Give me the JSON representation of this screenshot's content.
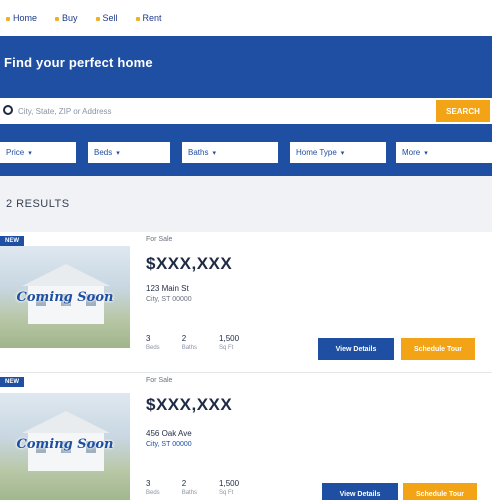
{
  "nav": {
    "items": [
      "Home",
      "Buy",
      "Sell",
      "Rent"
    ]
  },
  "hero": {
    "title": "Find your perfect home"
  },
  "search": {
    "placeholder": "City, State, ZIP or Address",
    "button_label": "SEARCH"
  },
  "filters": [
    "Price",
    "Beds",
    "Baths",
    "Home Type",
    "More"
  ],
  "results": {
    "count_label": "2 RESULTS"
  },
  "listings": [
    {
      "badge": "NEW",
      "photo_text": "Coming Soon",
      "status": "For Sale",
      "price": "$XXX,XXX",
      "address": "123 Main St",
      "city": "City, ST 00000",
      "stats": [
        {
          "value": "3",
          "label": "Beds"
        },
        {
          "value": "2",
          "label": "Baths"
        },
        {
          "value": "1,500",
          "label": "Sq Ft"
        }
      ],
      "details_label": "View Details",
      "tour_label": "Schedule Tour"
    },
    {
      "badge": "NEW",
      "photo_text": "Coming Soon",
      "status": "For Sale",
      "price": "$XXX,XXX",
      "address": "456 Oak Ave",
      "city": "City, ST 00000",
      "mls": "",
      "stats": [
        {
          "value": "3",
          "label": "Beds"
        },
        {
          "value": "2",
          "label": "Baths"
        },
        {
          "value": "1,500",
          "label": "Sq Ft"
        }
      ],
      "details_label": "View Details",
      "tour_label": "Schedule Tour"
    }
  ],
  "colors": {
    "brand_blue": "#1f4fa3",
    "accent_orange": "#f2a416"
  }
}
